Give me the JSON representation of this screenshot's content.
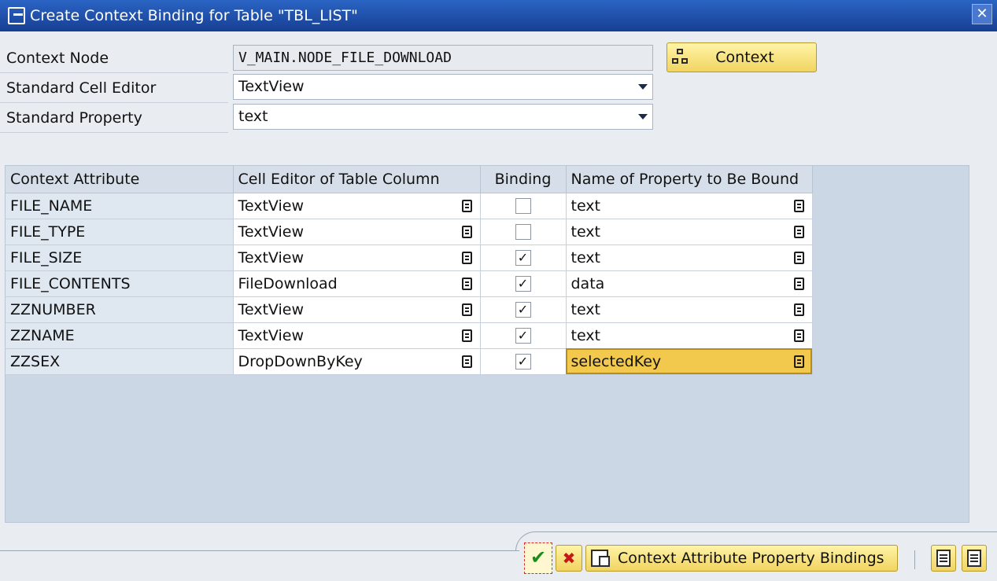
{
  "window": {
    "title": "Create Context Binding for Table \"TBL_LIST\"",
    "close_icon": "close-icon"
  },
  "form": {
    "context_node_label": "Context Node",
    "context_node_value": "V_MAIN.NODE_FILE_DOWNLOAD",
    "cell_editor_label": "Standard Cell Editor",
    "cell_editor_value": "TextView",
    "property_label": "Standard Property",
    "property_value": "text",
    "context_button_label": "Context"
  },
  "table": {
    "headers": [
      "Context Attribute",
      "Cell Editor of Table Column",
      "Binding",
      "Name of Property to Be Bound"
    ],
    "rows": [
      {
        "attribute": "FILE_NAME",
        "editor": "TextView",
        "binding": false,
        "property": "text"
      },
      {
        "attribute": "FILE_TYPE",
        "editor": "TextView",
        "binding": false,
        "property": "text"
      },
      {
        "attribute": "FILE_SIZE",
        "editor": "TextView",
        "binding": true,
        "property": "text"
      },
      {
        "attribute": "FILE_CONTENTS",
        "editor": "FileDownload",
        "binding": true,
        "property": "data"
      },
      {
        "attribute": "ZZNUMBER",
        "editor": "TextView",
        "binding": true,
        "property": "text"
      },
      {
        "attribute": "ZZNAME",
        "editor": "TextView",
        "binding": true,
        "property": "text"
      },
      {
        "attribute": "ZZSEX",
        "editor": "DropDownByKey",
        "binding": true,
        "property": "selectedKey"
      }
    ],
    "selected_row": 6
  },
  "footer": {
    "bindings_button_label": "Context Attribute Property Bindings"
  }
}
